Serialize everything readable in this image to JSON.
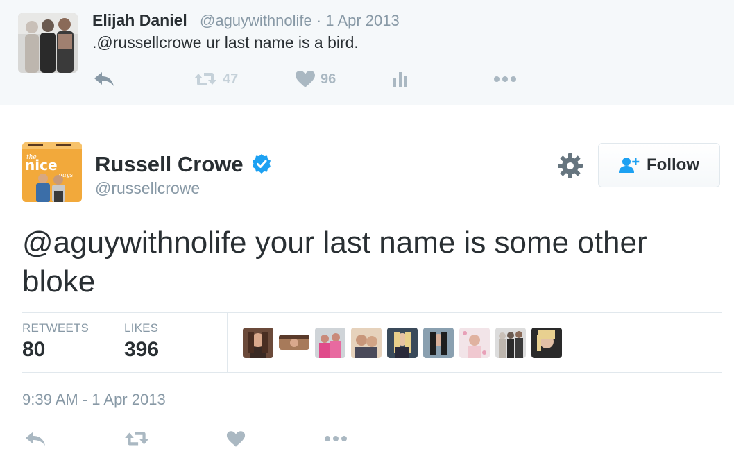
{
  "reply_tweet": {
    "author_name": "Elijah Daniel",
    "meta": "@aguywithnolife · 1 Apr 2013",
    "text": ".@russellcrowe ur last name is a bird.",
    "actions": {
      "reply_icon": "reply-icon",
      "retweet_count": "47",
      "like_count": "96",
      "analytics_icon": "analytics-icon",
      "more_icon": "more-icon"
    }
  },
  "main_tweet": {
    "author_name": "Russell Crowe",
    "handle": "@russellcrowe",
    "follow_label": "Follow",
    "text_mention": "@aguywithnolife",
    "text_rest": " your last name is some other bloke",
    "stats": {
      "retweets_label": "RETWEETS",
      "retweets_value": "80",
      "likes_label": "LIKES",
      "likes_value": "396"
    },
    "avatar_poster_text": {
      "brand": "the",
      "title": "nice",
      "sub": "guys"
    },
    "timestamp": "9:39 AM - 1 Apr 2013"
  },
  "colors": {
    "text_primary": "#292f33",
    "text_secondary": "#8899a6",
    "icon_muted": "#aab8c2",
    "verified_blue": "#1da1f2",
    "reply_bg": "#f5f8fa",
    "border": "#e1e8ed"
  }
}
